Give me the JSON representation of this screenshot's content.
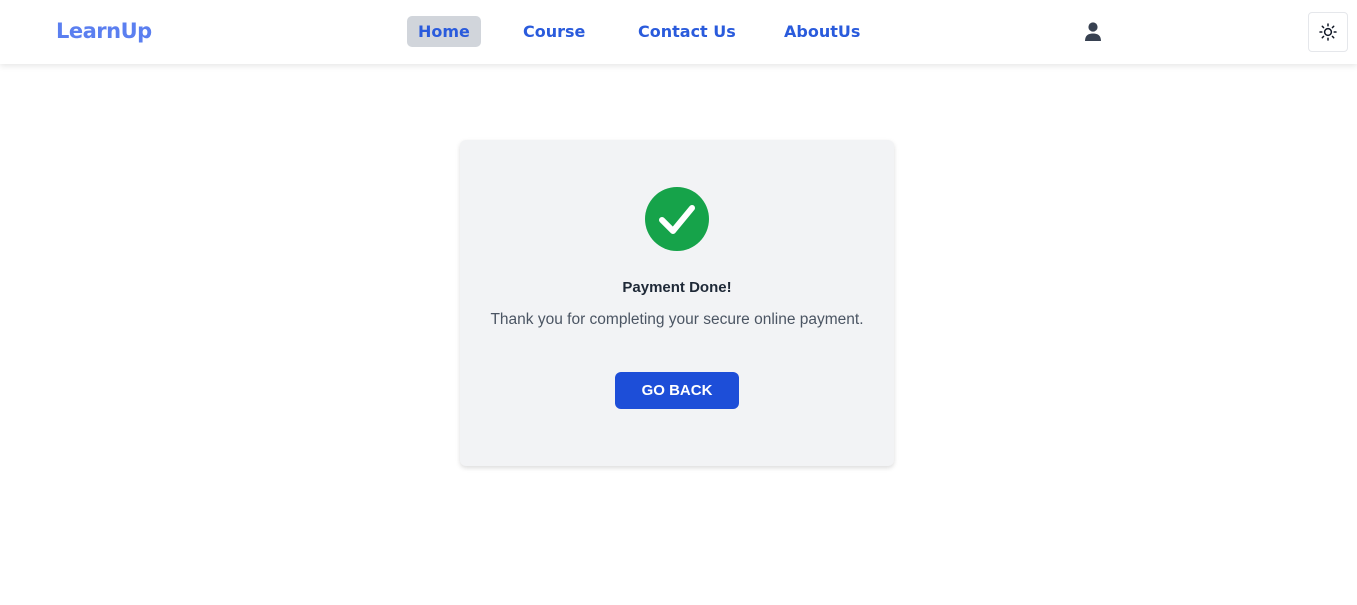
{
  "app": {
    "logo_text": "LearnUp"
  },
  "nav": {
    "links": [
      {
        "label": "Home",
        "active": true
      },
      {
        "label": "Course",
        "active": false
      },
      {
        "label": "Contact Us",
        "active": false
      },
      {
        "label": "AboutUs",
        "active": false
      }
    ],
    "user_icon": "user-icon",
    "theme_icon": "sun-icon"
  },
  "card": {
    "status_icon": "check-circle-icon",
    "title": "Payment Done!",
    "message": "Thank you for completing your secure online payment.",
    "button_label": "GO BACK"
  },
  "colors": {
    "brand": "#5b7ff0",
    "nav_link": "#2a5bdc",
    "active_nav_bg": "#d1d5db",
    "success": "#16a34a",
    "primary_button": "#1d4ed8",
    "card_bg": "#f2f3f5"
  }
}
